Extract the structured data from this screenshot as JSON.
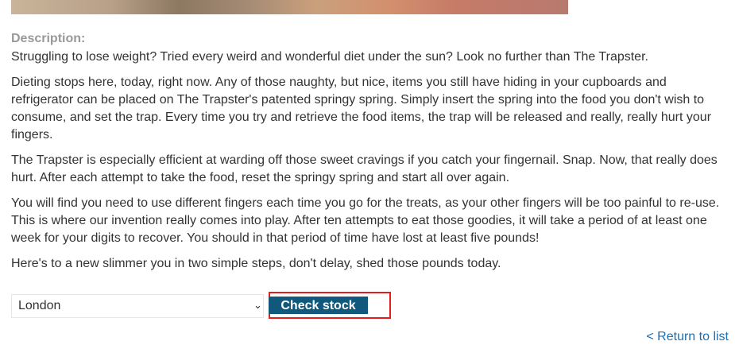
{
  "product": {
    "image_alt": "product image (partially visible)",
    "description_label": "Description:",
    "paragraphs": [
      "Struggling to lose weight? Tried every weird and wonderful diet under the sun? Look no further than The Trapster.",
      "Dieting stops here, today, right now. Any of those naughty, but nice, items you still have hiding in your cupboards and refrigerator can be placed on The Trapster's patented springy spring. Simply insert the spring into the food you don't wish to consume, and set the trap. Every time you try and retrieve the food items, the trap will be released and really, really hurt your fingers.",
      "The Trapster is especially efficient at warding off those sweet cravings if you catch your fingernail. Snap. Now, that really does hurt. After each attempt to take the food, reset the springy spring and start all over again.",
      "You will find you need to use different fingers each time you go for the treats, as your other fingers will be too painful to re-use. This is where our invention really comes into play. After ten attempts to eat those goodies, it will take a period of at least one week for your digits to recover. You should in that period of time have lost at least five pounds!",
      "Here's to a new slimmer you in two simple steps, don't delay, shed those pounds today."
    ]
  },
  "stock_check": {
    "selected_store": "London",
    "button_label": "Check stock"
  },
  "nav": {
    "return_link": "< Return to list"
  }
}
